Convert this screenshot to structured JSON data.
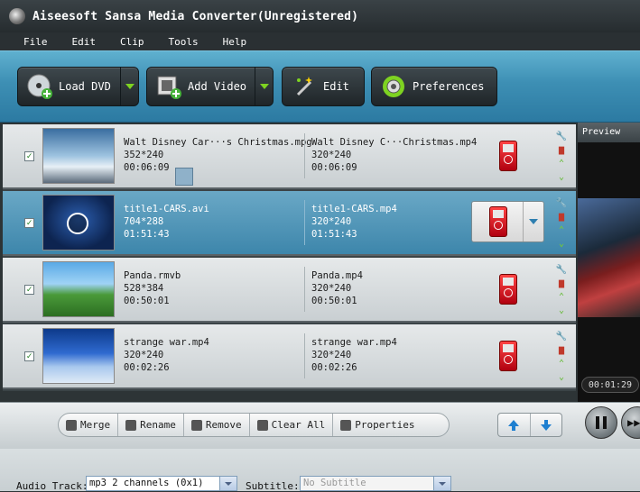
{
  "window": {
    "title": "Aiseesoft Sansa Media Converter(Unregistered)"
  },
  "menu": [
    "File",
    "Edit",
    "Clip",
    "Tools",
    "Help"
  ],
  "toolbar": {
    "load_dvd": "Load DVD",
    "add_video": "Add Video",
    "edit": "Edit",
    "preferences": "Preferences"
  },
  "files": [
    {
      "src_name": "Walt Disney Car···s Christmas.mpg",
      "src_res": "352*240",
      "src_dur": "00:06:09",
      "out_name": "Walt Disney C···Christmas.mp4",
      "out_res": "320*240",
      "out_dur": "00:06:09",
      "checked": true
    },
    {
      "src_name": "title1-CARS.avi",
      "src_res": "704*288",
      "src_dur": "01:51:43",
      "out_name": "title1-CARS.mp4",
      "out_res": "320*240",
      "out_dur": "01:51:43",
      "checked": true
    },
    {
      "src_name": "Panda.rmvb",
      "src_res": "528*384",
      "src_dur": "00:50:01",
      "out_name": "Panda.mp4",
      "out_res": "320*240",
      "out_dur": "00:50:01",
      "checked": true
    },
    {
      "src_name": "strange war.mp4",
      "src_res": "320*240",
      "src_dur": "00:02:26",
      "out_name": "strange war.mp4",
      "out_res": "320*240",
      "out_dur": "00:02:26",
      "checked": true
    }
  ],
  "preview": {
    "label": "Preview",
    "time": "00:01:29"
  },
  "bottom": {
    "merge": "Merge",
    "rename": "Rename",
    "remove": "Remove",
    "clear_all": "Clear All",
    "properties": "Properties"
  },
  "status": {
    "audio_label": "Audio Track:",
    "audio_value": "mp3 2 channels (0x1)",
    "subtitle_label": "Subtitle:",
    "subtitle_value": "No Subtitle"
  },
  "colors": {
    "toolbar": "#3d8fb4",
    "selected_row": "#4f93b6",
    "device": "#d0101e",
    "action_green": "#7ed321"
  }
}
